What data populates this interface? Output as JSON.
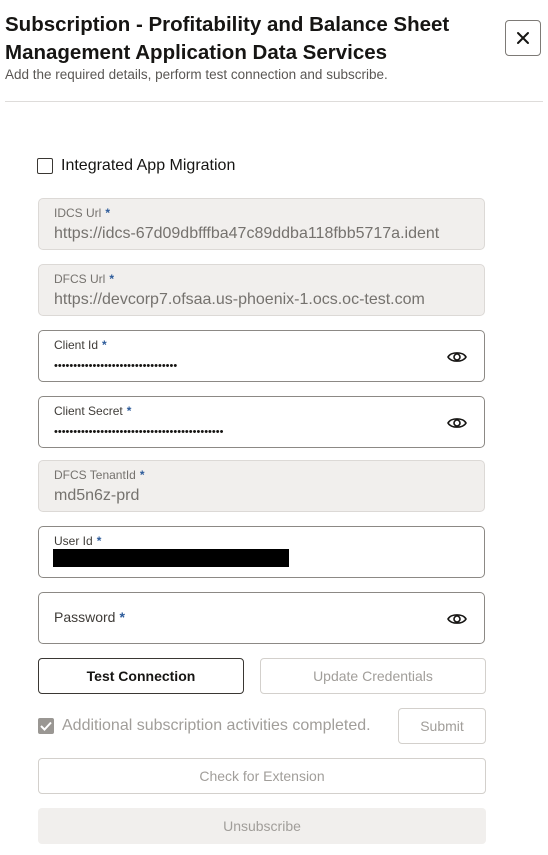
{
  "header": {
    "title": "Subscription - Profitability and Balance Sheet Management Application Data Services",
    "subtitle": "Add the required details, perform test connection and subscribe."
  },
  "integrated_migration": {
    "label": "Integrated App Migration",
    "checked": false
  },
  "fields": {
    "idcs_url": {
      "label": "IDCS Url",
      "value": "https://idcs-67d09dbfffba47c89ddba118fbb5717a.ident",
      "required": "*"
    },
    "dfcs_url": {
      "label": "DFCS Url",
      "value": "https://devcorp7.ofsaa.us-phoenix-1.ocs.oc-test.com",
      "required": "*"
    },
    "client_id": {
      "label": "Client Id",
      "value": "••••••••••••••••••••••••••••••••",
      "required": "*"
    },
    "client_secret": {
      "label": "Client Secret",
      "value": "••••••••••••••••••••••••••••••••••••••••••••",
      "required": "*"
    },
    "tenant_id": {
      "label": "DFCS TenantId",
      "value": "md5n6z-prd",
      "required": "*"
    },
    "user_id": {
      "label": "User Id",
      "required": "*"
    },
    "password": {
      "label": "Password",
      "required": "*"
    }
  },
  "buttons": {
    "test_connection": "Test Connection",
    "update_credentials": "Update Credentials",
    "submit": "Submit",
    "check_extension": "Check for Extension",
    "unsubscribe": "Unsubscribe"
  },
  "additional_activities": {
    "label": "Additional subscription activities completed.",
    "checked": true
  },
  "icons": {
    "close": "close-icon",
    "eye": "eye-icon",
    "check": "check-icon"
  },
  "colors": {
    "required_marker": "#2d5b9a",
    "readonly_bg": "#f1efed",
    "border_dark": "#3a3733"
  }
}
